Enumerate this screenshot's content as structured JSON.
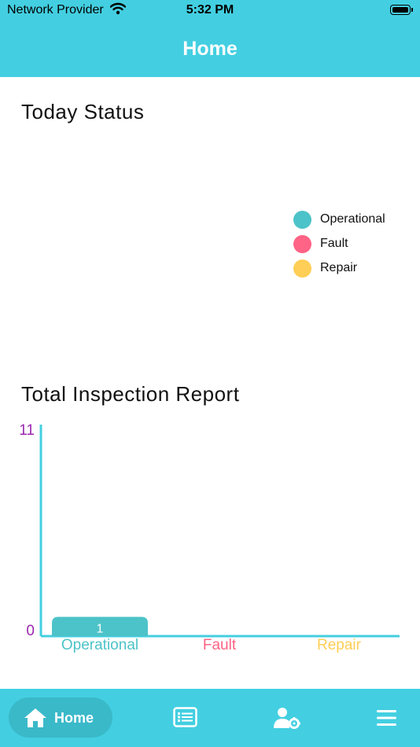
{
  "status_bar": {
    "carrier": "Network Provider",
    "time": "5:32 PM"
  },
  "header": {
    "title": "Home"
  },
  "today_status": {
    "title": "Today Status",
    "legend": [
      {
        "label": "Operational",
        "color": "#4cc3c8"
      },
      {
        "label": "Fault",
        "color": "#ff6385"
      },
      {
        "label": "Repair",
        "color": "#ffce56"
      }
    ]
  },
  "inspection_report": {
    "title": "Total Inspection Report"
  },
  "chart_data": {
    "type": "bar",
    "categories": [
      "Operational",
      "Fault",
      "Repair"
    ],
    "values": [
      1,
      0,
      0
    ],
    "data_labels": [
      "1",
      "",
      ""
    ],
    "colors": [
      "#4cc3c8",
      "#ff6385",
      "#ffce56"
    ],
    "ylim": [
      0,
      11
    ],
    "y_ticks": [
      "0",
      "11"
    ],
    "axis_color": "#43cfe1",
    "tick_label_color": "#9c27b0",
    "grid": false,
    "legend": "none"
  },
  "tab_bar": {
    "home_label": "Home",
    "icons": [
      "home-icon",
      "list-icon",
      "user-settings-icon",
      "menu-icon"
    ]
  }
}
